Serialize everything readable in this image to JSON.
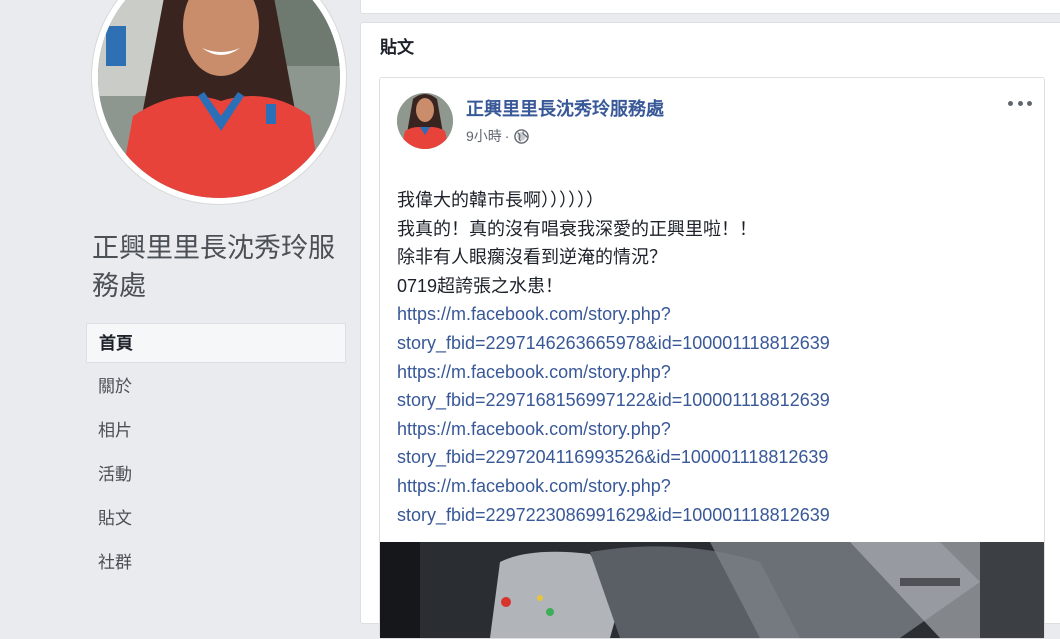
{
  "page": {
    "name": "正興里里長沈秀玲服務處"
  },
  "nav": {
    "items": [
      {
        "label": "首頁",
        "active": true
      },
      {
        "label": "關於",
        "active": false
      },
      {
        "label": "相片",
        "active": false
      },
      {
        "label": "活動",
        "active": false
      },
      {
        "label": "貼文",
        "active": false
      },
      {
        "label": "社群",
        "active": false
      }
    ]
  },
  "posts_section": {
    "title": "貼文"
  },
  "post": {
    "author": "正興里里長沈秀玲服務處",
    "time": "9小時",
    "separator": "·",
    "privacy_icon": "globe-icon",
    "more_icon": "more-options-icon",
    "lines": [
      "我偉大的韓市長啊））））））",
      "我真的！真的沒有唱衰我深愛的正興里啦！！",
      "除非有人眼瘸沒看到逆淹的情況？",
      "0719超誇張之水患！"
    ],
    "links": [
      {
        "line1": "https://m.facebook.com/story.php?",
        "line2": "story_fbid=2297146263665978&id=100001118812639"
      },
      {
        "line1": "https://m.facebook.com/story.php?",
        "line2": "story_fbid=2297168156997122&id=100001118812639"
      },
      {
        "line1": "https://m.facebook.com/story.php?",
        "line2": "story_fbid=2297204116993526&id=100001118812639"
      },
      {
        "line1": "https://m.facebook.com/story.php?",
        "line2": "story_fbid=2297223086991629&id=100001118812639"
      }
    ]
  },
  "colors": {
    "background": "#e9ebee",
    "link": "#385898",
    "text": "#1d2129",
    "secondary_text": "#616770",
    "border": "#dddfe2"
  }
}
